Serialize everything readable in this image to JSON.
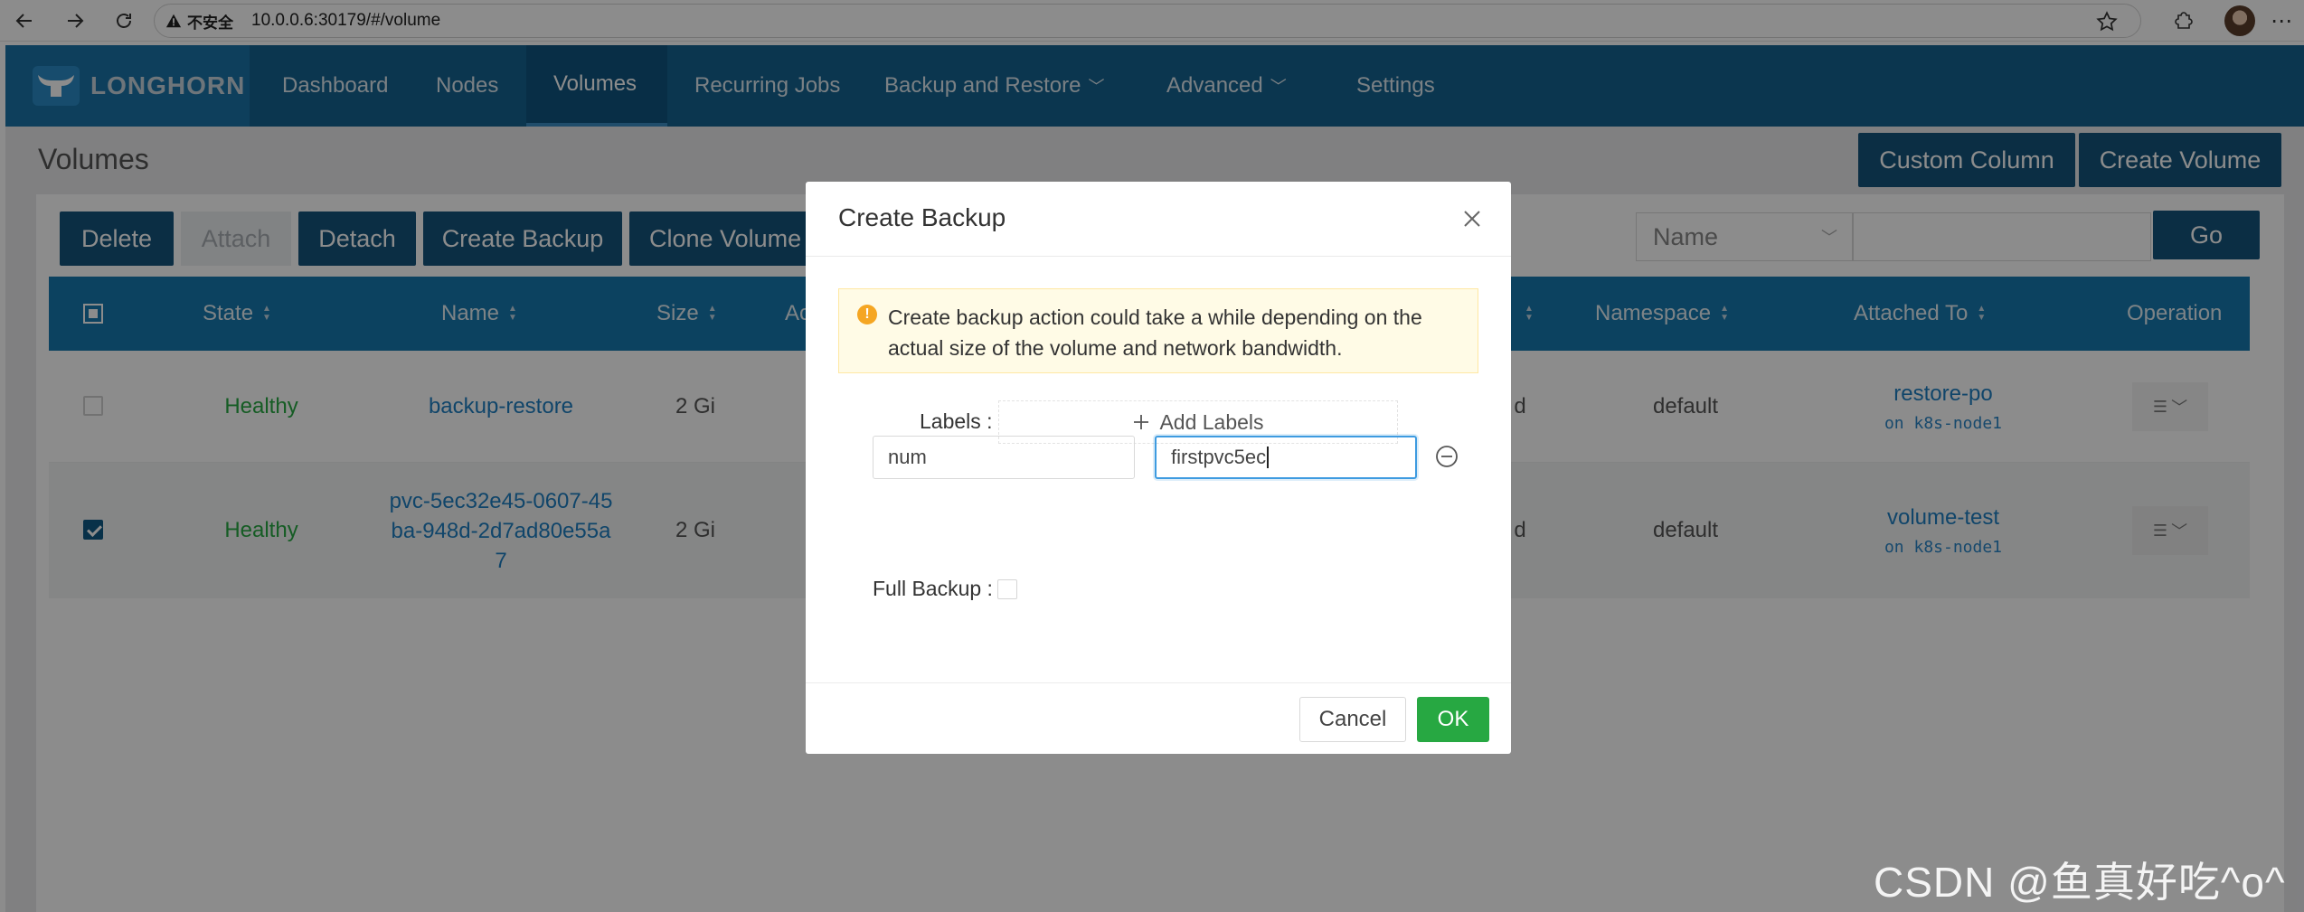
{
  "browser": {
    "security_label": "不安全",
    "url": "10.0.0.6:30179/#/volume"
  },
  "app": {
    "logo": "LONGHORN",
    "nav": [
      {
        "label": "Dashboard"
      },
      {
        "label": "Nodes"
      },
      {
        "label": "Volumes"
      },
      {
        "label": "Recurring Jobs"
      },
      {
        "label": "Backup and Restore"
      },
      {
        "label": "Advanced"
      },
      {
        "label": "Settings"
      }
    ]
  },
  "page": {
    "title": "Volumes",
    "custom_column": "Custom Column",
    "create_volume": "Create Volume",
    "actions": {
      "delete": "Delete",
      "attach": "Attach",
      "detach": "Detach",
      "create_backup": "Create Backup",
      "clone_volume": "Clone Volume"
    },
    "filter": {
      "field": "Name",
      "go": "Go"
    }
  },
  "table": {
    "headers": {
      "state": "State",
      "name": "Name",
      "size": "Size",
      "actual": "Ac",
      "namespace": "Namespace",
      "attached_to": "Attached To",
      "operation": "Operation"
    },
    "rows": [
      {
        "state": "Healthy",
        "name": "backup-restore",
        "size": "2 Gi",
        "hidden_col_tail": "d",
        "namespace": "default",
        "attached_pod": "restore-po",
        "attached_node": "on k8s-node1",
        "checked": false
      },
      {
        "state": "Healthy",
        "name_line1": "pvc-5ec32e45-0607-45",
        "name_line2": "ba-948d-2d7ad80e55a",
        "name_line3": "7",
        "size": "2 Gi",
        "hidden_col_tail": "d",
        "namespace": "default",
        "attached_pod": "volume-test",
        "attached_node": "on k8s-node1",
        "checked": true
      }
    ]
  },
  "modal": {
    "title": "Create Backup",
    "alert_line1": "Create backup action could take a while depending on the",
    "alert_line2": "actual size of the volume and network bandwidth.",
    "labels_label": "Labels :",
    "add_labels": "Add Labels",
    "label_key": "num",
    "label_value": "firstpvc5ec",
    "full_backup_label": "Full Backup :",
    "cancel": "Cancel",
    "ok": "OK"
  },
  "watermark": "CSDN @鱼真好吃^o^"
}
